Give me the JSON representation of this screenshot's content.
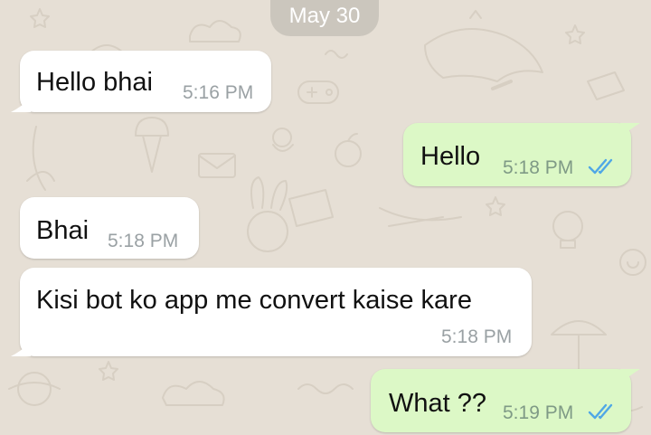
{
  "date_separator": "May 30",
  "colors": {
    "background": "#e6dfd5",
    "incoming_bubble": "#ffffff",
    "outgoing_bubble": "#dcf8c6",
    "read_tick": "#4fa7e6"
  },
  "messages": [
    {
      "direction": "incoming",
      "text": "Hello bhai",
      "time": "5:16 PM"
    },
    {
      "direction": "outgoing",
      "text": "Hello",
      "time": "5:18 PM",
      "status_icon": "double-check-read-icon"
    },
    {
      "direction": "incoming",
      "text": "Bhai",
      "time": "5:18 PM"
    },
    {
      "direction": "incoming",
      "text": "Kisi bot ko app me convert kaise kare",
      "time": "5:18 PM"
    },
    {
      "direction": "outgoing",
      "text": "What ??",
      "time": "5:19 PM",
      "status_icon": "double-check-read-icon"
    }
  ]
}
